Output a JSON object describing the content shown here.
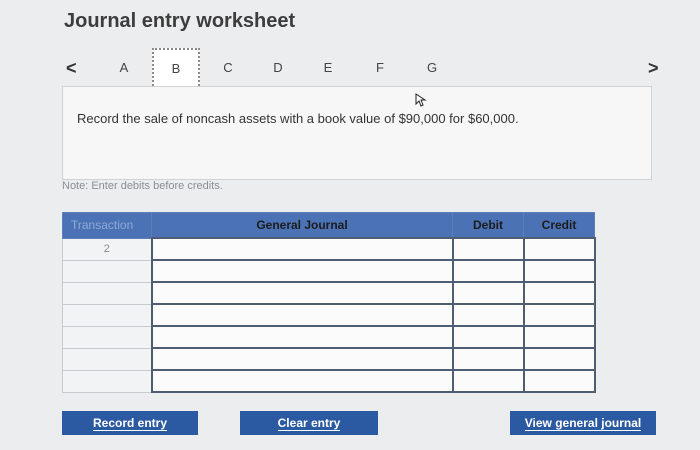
{
  "header": {
    "title": "Journal entry worksheet"
  },
  "tabs": {
    "prev": "<",
    "next": ">",
    "items": [
      {
        "label": "A"
      },
      {
        "label": "B"
      },
      {
        "label": "C"
      },
      {
        "label": "D"
      },
      {
        "label": "E"
      },
      {
        "label": "F"
      },
      {
        "label": "G"
      }
    ],
    "active": "B"
  },
  "prompt": {
    "text": "Record the sale of noncash assets with a book value of $90,000 for $60,000."
  },
  "note": "Note: Enter debits before credits.",
  "table": {
    "headers": {
      "transaction": "Transaction",
      "journal": "General Journal",
      "debit": "Debit",
      "credit": "Credit"
    },
    "rows": [
      {
        "transaction": "2",
        "journal": "",
        "debit": "",
        "credit": ""
      },
      {
        "transaction": "",
        "journal": "",
        "debit": "",
        "credit": ""
      },
      {
        "transaction": "",
        "journal": "",
        "debit": "",
        "credit": ""
      },
      {
        "transaction": "",
        "journal": "",
        "debit": "",
        "credit": ""
      },
      {
        "transaction": "",
        "journal": "",
        "debit": "",
        "credit": ""
      },
      {
        "transaction": "",
        "journal": "",
        "debit": "",
        "credit": ""
      },
      {
        "transaction": "",
        "journal": "",
        "debit": "",
        "credit": ""
      }
    ]
  },
  "buttons": {
    "record": "Record entry",
    "clear": "Clear entry",
    "view": "View general journal"
  },
  "icons": {
    "cursor": "cursor-pointer-icon"
  },
  "colors": {
    "header_blue": "#4a72b5",
    "button_blue": "#2c5aa2"
  }
}
